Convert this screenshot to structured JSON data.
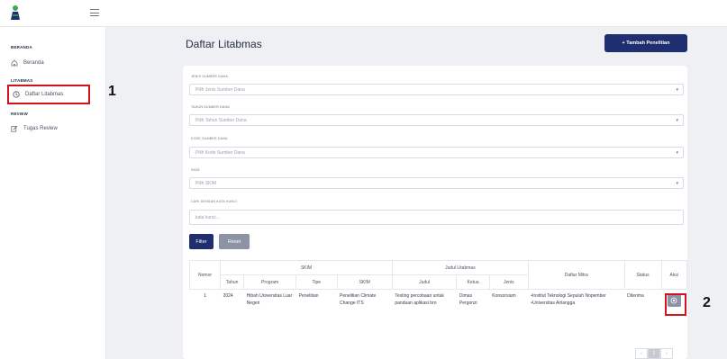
{
  "sidebar": {
    "sections": [
      {
        "title": "BERANDA",
        "items": [
          {
            "label": "Beranda",
            "icon": "home-icon"
          }
        ]
      },
      {
        "title": "LITABMAS",
        "items": [
          {
            "label": "Daftar Litabmas",
            "icon": "clock-icon",
            "active": true
          }
        ]
      },
      {
        "title": "REVIEW",
        "items": [
          {
            "label": "Tugas Review",
            "icon": "edit-icon"
          }
        ]
      }
    ]
  },
  "callouts": [
    "1",
    "2"
  ],
  "page": {
    "title": "Daftar Litabmas",
    "add_button": "+ Tambah Penelitian"
  },
  "filters": {
    "jenis_label": "JENIS SUMBER DANA",
    "jenis_placeholder": "Pilih Jenis Sumber Dana",
    "tahun_label": "TAHUN SUMBER DANA",
    "tahun_placeholder": "Pilih Tahun Sumber Dana",
    "kode_label": "KODE SUMBER DANA",
    "kode_placeholder": "Pilih Kode Sumber Dana",
    "skim_label": "SKIM",
    "skim_placeholder": "Pilih SKIM",
    "keyword_label": "CARI DENGAN KATA KUNCI",
    "keyword_placeholder": "kata kunci...",
    "filter_button": "Filter",
    "reset_button": "Reset"
  },
  "table": {
    "headers": {
      "nomor": "Nomor",
      "skim_group": "SKIM",
      "judul_group": "Judul Litabmas",
      "mitra": "Daftar Mitra",
      "status": "Status",
      "aksi": "Aksi",
      "tahun": "Tahun",
      "program": "Program",
      "tipe": "Tipe",
      "skim": "SKIM",
      "judul": "Judul",
      "ketua": "Ketua",
      "jenis": "Jenis"
    },
    "rows": [
      {
        "nomor": "1",
        "tahun": "2024",
        "program": "Hibah Universitas Luar Negeri",
        "tipe": "Penelitian",
        "skim": "Penelitian Climate Change ITS",
        "judul": "Testing percobaan untuk panduan aplikasi bro",
        "ketua": "Dimas Pergonzi",
        "jenis": "Konsorsium",
        "mitra": [
          "Institut Teknologi Sepuluh Nopember",
          "Universitas Airlangga"
        ],
        "status": "Diterima"
      }
    ]
  },
  "pagination": {
    "prev": "‹",
    "current": "1",
    "next": "›"
  },
  "colors": {
    "primary": "#1f2e6e",
    "annotation": "#d1141c",
    "logo_green": "#3fa65a"
  }
}
